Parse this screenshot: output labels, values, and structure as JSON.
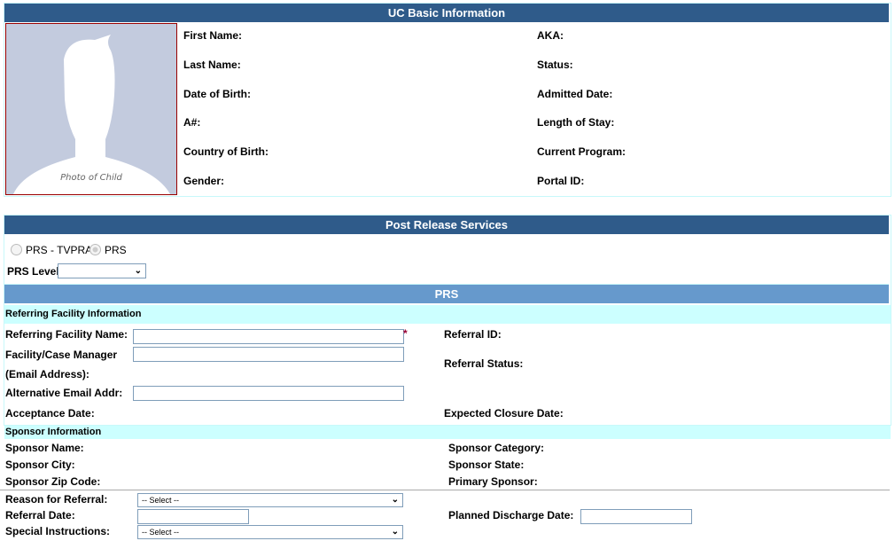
{
  "basic": {
    "title": "UC Basic Information",
    "photo_caption": "Photo of Child",
    "left_fields": [
      "First Name:",
      "Last Name:",
      "Date of Birth:",
      "A#:",
      "Country of Birth:",
      "Gender:"
    ],
    "right_fields": [
      "AKA:",
      "Status:",
      "Admitted Date:",
      "Length of Stay:",
      "Current Program:",
      "Portal ID:"
    ]
  },
  "prs_services": {
    "title": "Post Release Services",
    "radio_tvpra": "PRS - TVPRA",
    "radio_prs": "PRS",
    "level_label": "PRS Level:",
    "level_value": ""
  },
  "prs": {
    "title": "PRS",
    "referring": {
      "title": "Referring Facility Information",
      "facility_name": "Referring Facility Name:",
      "required": "*",
      "case_manager": "Facility/Case Manager",
      "email": "(Email Address):",
      "alt_email": "Alternative Email Addr:",
      "acceptance": "Acceptance Date:",
      "referral_id": "Referral ID:",
      "referral_status": "Referral Status:",
      "expected_closure": "Expected Closure Date:"
    },
    "sponsor": {
      "title": "Sponsor Information",
      "name": "Sponsor Name:",
      "city": "Sponsor City:",
      "zip": "Sponsor Zip Code:",
      "category": "Sponsor Category:",
      "state": "Sponsor State:",
      "primary": "Primary Sponsor:"
    },
    "referral": {
      "reason": "Reason for Referral:",
      "reason_value": "-- Select --",
      "date": "Referral Date:",
      "planned": "Planned Discharge Date:",
      "special": "Special Instructions:",
      "special_value": "-- Select --"
    }
  }
}
